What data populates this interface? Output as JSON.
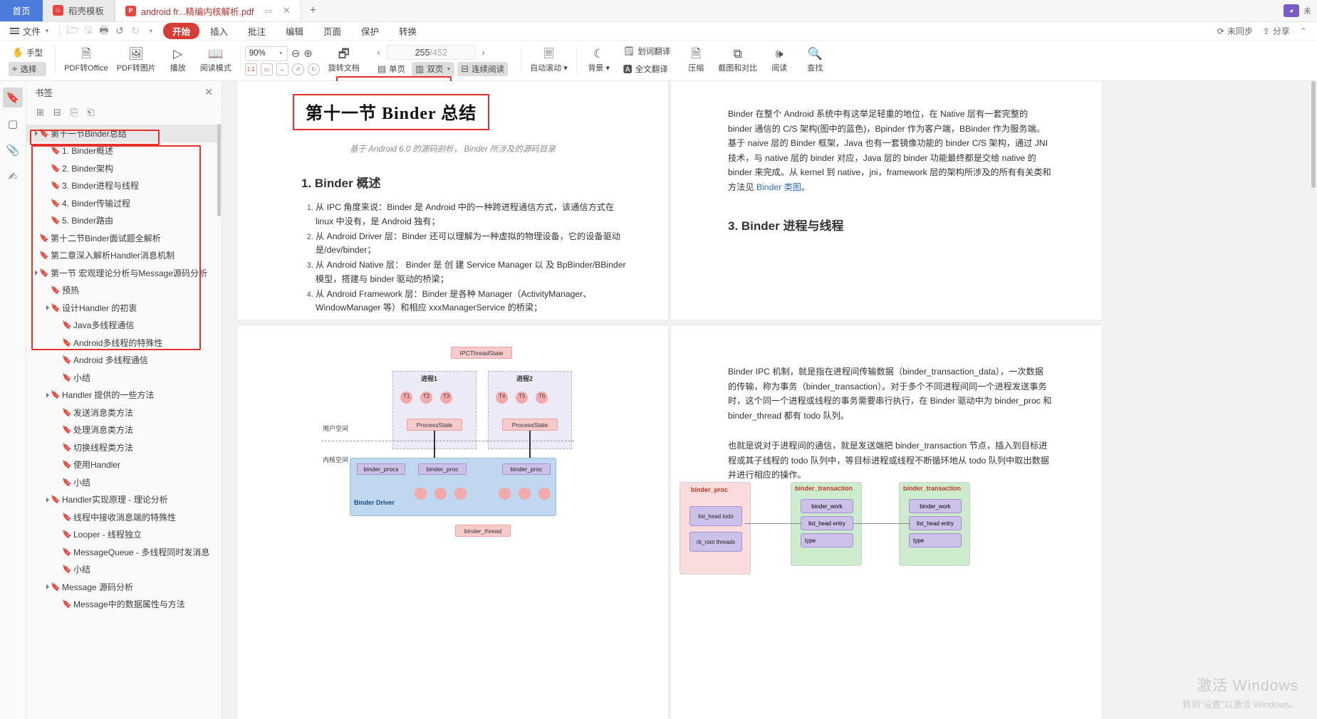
{
  "window": {
    "tabs": [
      {
        "label": "首页",
        "icon": "home-icon",
        "state": "home"
      },
      {
        "label": "稻壳模板",
        "icon": "wps-docer-icon",
        "state": "inactive"
      },
      {
        "label": "android fr...精编内核解析.pdf",
        "icon": "pdf-icon",
        "state": "active"
      }
    ],
    "new_tab_label": "+"
  },
  "menu": {
    "file_label": "文件",
    "quick_icons": [
      "open-icon",
      "save-icon",
      "print-icon",
      "undo-icon",
      "redo-icon",
      "customize-icon"
    ],
    "ribbon_tabs": [
      {
        "label": "开始",
        "active": true
      },
      {
        "label": "插入",
        "active": false
      },
      {
        "label": "批注",
        "active": false
      },
      {
        "label": "编辑",
        "active": false
      },
      {
        "label": "页面",
        "active": false
      },
      {
        "label": "保护",
        "active": false
      },
      {
        "label": "转换",
        "active": false
      }
    ],
    "right_items": [
      {
        "label": "未同步",
        "icon": "sync-icon"
      },
      {
        "label": "分享",
        "icon": "share-icon"
      }
    ]
  },
  "toolbar": {
    "hand_tool": "手型",
    "select_tool": "选择",
    "pdf_to_office": "PDF转Office",
    "pdf_to_image": "PDF转图片",
    "play": "播放",
    "read_mode": "阅读模式",
    "zoom_value": "90%",
    "zoom_out_icon": "zoom-out-icon",
    "zoom_in_icon": "zoom-in-icon",
    "fit_icons": [
      "actual-size-icon",
      "fit-page-icon",
      "fit-width-icon",
      "rotate-left-icon",
      "rotate-right-icon"
    ],
    "rotate_doc": "旋转文档",
    "page_current": "255",
    "page_total": "/452",
    "prev_arrow": "‹",
    "next_arrow": "›",
    "single_page": "单页",
    "double_page": "双页",
    "continuous_read": "连续阅读",
    "auto_scroll": "自动滚动",
    "background": "背景",
    "word_translate": "划词翻译",
    "full_translate": "全文翻译",
    "compress": "压缩",
    "screenshot_compare": "截图和对比",
    "read_aloud": "阅读",
    "find": "查找"
  },
  "sidebar": {
    "rails": [
      {
        "name": "bookmark-rail",
        "icon": "bookmark-icon",
        "active": true
      },
      {
        "name": "thumbnail-rail",
        "icon": "page-icon",
        "active": false
      },
      {
        "name": "attachment-rail",
        "icon": "paperclip-icon",
        "active": false
      },
      {
        "name": "annotation-rail",
        "icon": "stamp-icon",
        "active": false
      }
    ],
    "panel_title": "书签",
    "panel_tools": [
      "add-bookmark-icon",
      "remove-bookmark-icon",
      "expand-bookmark-icon",
      "collapse-bookmark-icon"
    ],
    "items": [
      {
        "label": "第十一节Binder总结",
        "depth": 0,
        "caret": "▲",
        "selected": true,
        "highlight": "title"
      },
      {
        "label": "1. Binder概述",
        "depth": 1,
        "caret": "",
        "selected": false
      },
      {
        "label": "2. Binder架构",
        "depth": 1,
        "caret": "",
        "selected": false
      },
      {
        "label": "3. Binder进程与线程",
        "depth": 1,
        "caret": "",
        "selected": false
      },
      {
        "label": "4. Binder传输过程",
        "depth": 1,
        "caret": "",
        "selected": false
      },
      {
        "label": "5. Binder路由",
        "depth": 1,
        "caret": "",
        "selected": false
      },
      {
        "label": "第十二节Binder面试题全解析",
        "depth": 0,
        "caret": "",
        "selected": false
      },
      {
        "label": "第二章深入解析Handler消息机制",
        "depth": 0,
        "caret": "",
        "selected": false
      },
      {
        "label": "第一节 宏观理论分析与Message源码分析",
        "depth": 0,
        "caret": "▲",
        "selected": false
      },
      {
        "label": "预热",
        "depth": 1,
        "caret": "",
        "selected": false
      },
      {
        "label": "设计Handler 的初衷",
        "depth": 1,
        "caret": "▲",
        "selected": false
      },
      {
        "label": "Java多线程通信",
        "depth": 2,
        "caret": "",
        "selected": false
      },
      {
        "label": "Android多线程的特殊性",
        "depth": 2,
        "caret": "",
        "selected": false
      },
      {
        "label": "Android 多线程通信",
        "depth": 2,
        "caret": "",
        "selected": false
      },
      {
        "label": "小结",
        "depth": 2,
        "caret": "",
        "selected": false
      },
      {
        "label": "Handler 提供的一些方法",
        "depth": 1,
        "caret": "▲",
        "selected": false
      },
      {
        "label": "发送消息类方法",
        "depth": 2,
        "caret": "",
        "selected": false
      },
      {
        "label": "处理消息类方法",
        "depth": 2,
        "caret": "",
        "selected": false
      },
      {
        "label": "切换线程类方法",
        "depth": 2,
        "caret": "",
        "selected": false
      },
      {
        "label": "使用Handler",
        "depth": 2,
        "caret": "",
        "selected": false
      },
      {
        "label": "小结",
        "depth": 2,
        "caret": "",
        "selected": false
      },
      {
        "label": "Handler实现原理 - 理论分析",
        "depth": 1,
        "caret": "▲",
        "selected": false
      },
      {
        "label": "线程中接收消息端的特殊性",
        "depth": 2,
        "caret": "",
        "selected": false
      },
      {
        "label": "Looper - 线程独立",
        "depth": 2,
        "caret": "",
        "selected": false
      },
      {
        "label": "MessageQueue - 多线程同时发消息",
        "depth": 2,
        "caret": "",
        "selected": false
      },
      {
        "label": "小结",
        "depth": 2,
        "caret": "",
        "selected": false
      },
      {
        "label": "Message 源码分析",
        "depth": 1,
        "caret": "▲",
        "selected": false
      },
      {
        "label": "Message中的数据属性与方法",
        "depth": 2,
        "caret": "",
        "selected": false
      }
    ]
  },
  "document": {
    "page_left_top": {
      "title": "第十一节 Binder 总结",
      "subtitle": "基于 Android 6.0 的源码剖析， Binder 所涉及的源码目录",
      "heading": "1. Binder 概述",
      "list": [
        "从 IPC 角度来说：Binder 是 Android 中的一种跨进程通信方式，该通信方式在 linux 中没有，是 Android 独有；",
        "从 Android Driver 层：Binder 还可以理解为一种虚拟的物理设备，它的设备驱动是/dev/binder；",
        "从 Android Native 层： Binder 是 创 建 Service Manager 以 及 BpBinder/BBinder 模型，搭建与 binder 驱动的桥梁；",
        "从 Android Framework 层：Binder 是各种 Manager（ActivityManager、WindowManager 等）和相应 xxxManagerService 的桥梁；"
      ]
    },
    "page_right_top": {
      "paragraph": "Binder 在整个 Android 系统中有这举足轻重的地位，在 Native 层有一套完整的 binder 通信的 C/S 架构(图中的蓝色)，Bpinder 作为客户端，BBinder 作为服务端。基于 naive 层的 Binder 框架，Java 也有一套镜像功能的 binder C/S 架构，通过 JNI 技术，与 native 层的 binder 对应，Java 层的 binder 功能最终都是交给 native 的 binder 来完成。从 kernel 到 native，jni，framework 层的架构所涉及的所有有关类和方法见 ",
      "paragraph_link": "Binder 类图",
      "paragraph_tail": "。",
      "heading": "3. Binder 进程与线程"
    },
    "page_right_bottom": {
      "paragraph1": "Binder IPC 机制，就是指在进程间传输数据（binder_transaction_data），一次数据的传输，称为事务（binder_transaction）。对于多个不同进程间同一个进程发送事务时，这个同一个进程或线程的事务需要串行执行，在 Binder 驱动中为 binder_proc 和 binder_thread 都有 todo 队列。",
      "paragraph2": "也就是说对于进程间的通信，就是发送端把 binder_transaction 节点，插入到目标进程或其子线程的 todo 队列中，等目标进程或线程不断循环地从 todo 队列中取出数据并进行相应的操作。"
    },
    "diagram_left": {
      "top_node": "IPCThreadState",
      "proc1": "进程1",
      "proc2": "进程2",
      "threads1": [
        "T1",
        "T2",
        "T3"
      ],
      "threads2": [
        "T4",
        "T5",
        "T6"
      ],
      "ps1": "ProcessState",
      "ps2": "ProcessState",
      "user_space": "用户空间",
      "kernel_space": "内核空间",
      "binder_procs": "binder_procs",
      "binder_proc1": "binder_proc",
      "binder_proc2": "binder_proc",
      "binder_driver": "Binder Driver",
      "binder_thread": "binder_thread"
    },
    "diagram_right": {
      "group1_title": "binder_proc",
      "group1_rows": [
        "list_head todo",
        "rb_root threads"
      ],
      "group2_title": "binder_transaction",
      "group2_rows": [
        "binder_work",
        "list_head entry",
        "type"
      ],
      "group3_title": "binder_transaction",
      "group3_rows": [
        "binder_work",
        "list_head entry",
        "type"
      ]
    }
  },
  "watermark": {
    "line1": "激活 Windows",
    "line2": "转到\"设置\"以激活 Windows。"
  },
  "colors": {
    "accent_red": "#d93b36",
    "annotation_red": "#e8302a",
    "tab_blue": "#4a7ddb",
    "link_blue": "#2f6fc2"
  }
}
